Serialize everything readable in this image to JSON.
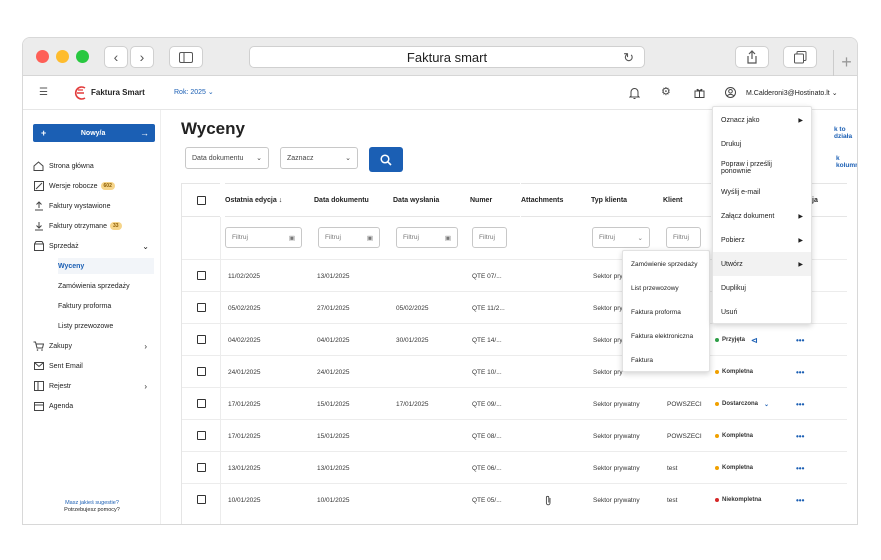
{
  "window": {
    "title": "Faktura smart"
  },
  "header": {
    "brand": "Faktura Smart",
    "year_label": "Rok: 2025",
    "user_email": "M.Calderoni3@Hostinato.lt"
  },
  "sidebar": {
    "new_button": "Nowy/a",
    "items": [
      {
        "label": "Strona główna",
        "icon": "home-icon"
      },
      {
        "label": "Wersje robocze",
        "icon": "draft-icon",
        "badge": "602"
      },
      {
        "label": "Faktury wystawione",
        "icon": "upload-icon"
      },
      {
        "label": "Faktury otrzymane",
        "icon": "download-icon",
        "badge": "33"
      },
      {
        "label": "Sprzedaż",
        "icon": "store-icon"
      }
    ],
    "subitems": [
      "Wyceny",
      "Zamówienia sprzedaży",
      "Faktury proforma",
      "Listy przewozowe"
    ],
    "items2": [
      {
        "label": "Zakupy",
        "icon": "cart-icon"
      },
      {
        "label": "Sent Email",
        "icon": "sent-icon"
      },
      {
        "label": "Rejestr",
        "icon": "register-icon"
      },
      {
        "label": "Agenda",
        "icon": "calendar-icon"
      }
    ],
    "footer": [
      "Masz jakieś sugestie?",
      "Potrzebujesz pomocy?"
    ]
  },
  "main": {
    "title": "Wyceny",
    "date_select": "Data dokumentu",
    "mark_select": "Zaznacz",
    "right_links": [
      "k to działa",
      "k kolumny"
    ],
    "columns": [
      "Ostatnia edycja ↓",
      "Data dokumentu",
      "Data wysłania",
      "Numer",
      "Attachments",
      "Typ klienta",
      "Klient",
      "ja"
    ],
    "filter_placeholder": "Filtruj",
    "rows": [
      {
        "edit": "11/02/2025",
        "doc": "13/01/2025",
        "sent": "",
        "num": "QTE 07/...",
        "att": "",
        "type": "Sektor pry",
        "client": "",
        "status": "",
        "scolor": ""
      },
      {
        "edit": "05/02/2025",
        "doc": "27/01/2025",
        "sent": "05/02/2025",
        "num": "QTE 11/2...",
        "att": "",
        "type": "Sektor pry",
        "client": "",
        "status": "",
        "scolor": ""
      },
      {
        "edit": "04/02/2025",
        "doc": "04/01/2025",
        "sent": "30/01/2025",
        "num": "QTE 14/...",
        "att": "",
        "type": "Sektor pry",
        "client": "",
        "status": "Przyjęta",
        "scolor": "#2e9e47"
      },
      {
        "edit": "24/01/2025",
        "doc": "24/01/2025",
        "sent": "",
        "num": "QTE 10/...",
        "att": "",
        "type": "Sektor pry",
        "client": "",
        "status": "Kompletna",
        "scolor": "#f0a000"
      },
      {
        "edit": "17/01/2025",
        "doc": "15/01/2025",
        "sent": "17/01/2025",
        "num": "QTE 09/...",
        "att": "",
        "type": "Sektor prywatny",
        "client": "POWSZECI",
        "status": "Dostarczona",
        "scolor": "#f0a000"
      },
      {
        "edit": "17/01/2025",
        "doc": "15/01/2025",
        "sent": "",
        "num": "QTE 08/...",
        "att": "",
        "type": "Sektor prywatny",
        "client": "POWSZECI",
        "status": "Kompletna",
        "scolor": "#f0a000"
      },
      {
        "edit": "13/01/2025",
        "doc": "13/01/2025",
        "sent": "",
        "num": "QTE 06/...",
        "att": "",
        "type": "Sektor prywatny",
        "client": "test",
        "status": "Kompletna",
        "scolor": "#f0a000"
      },
      {
        "edit": "10/01/2025",
        "doc": "10/01/2025",
        "sent": "",
        "num": "QTE 05/...",
        "att": "clip",
        "type": "Sektor prywatny",
        "client": "test",
        "status": "Niekompletna",
        "scolor": "#d62828"
      }
    ]
  },
  "actions_menu": {
    "items": [
      {
        "label": "Oznacz jako",
        "sub": true
      },
      {
        "label": "Drukuj",
        "sub": false
      },
      {
        "label": "Popraw i prześlij ponownie",
        "sub": false
      },
      {
        "label": "Wyślij e-mail",
        "sub": false
      },
      {
        "label": "Załącz dokument",
        "sub": true
      },
      {
        "label": "Pobierz",
        "sub": true
      },
      {
        "label": "Utwórz",
        "sub": true
      },
      {
        "label": "Duplikuj",
        "sub": false
      },
      {
        "label": "Usuń",
        "sub": false
      }
    ]
  },
  "create_submenu": {
    "items": [
      "Zamówienie sprzedaży",
      "List przewozowy",
      "Faktura proforma",
      "Faktura elektroniczna",
      "Faktura"
    ]
  }
}
